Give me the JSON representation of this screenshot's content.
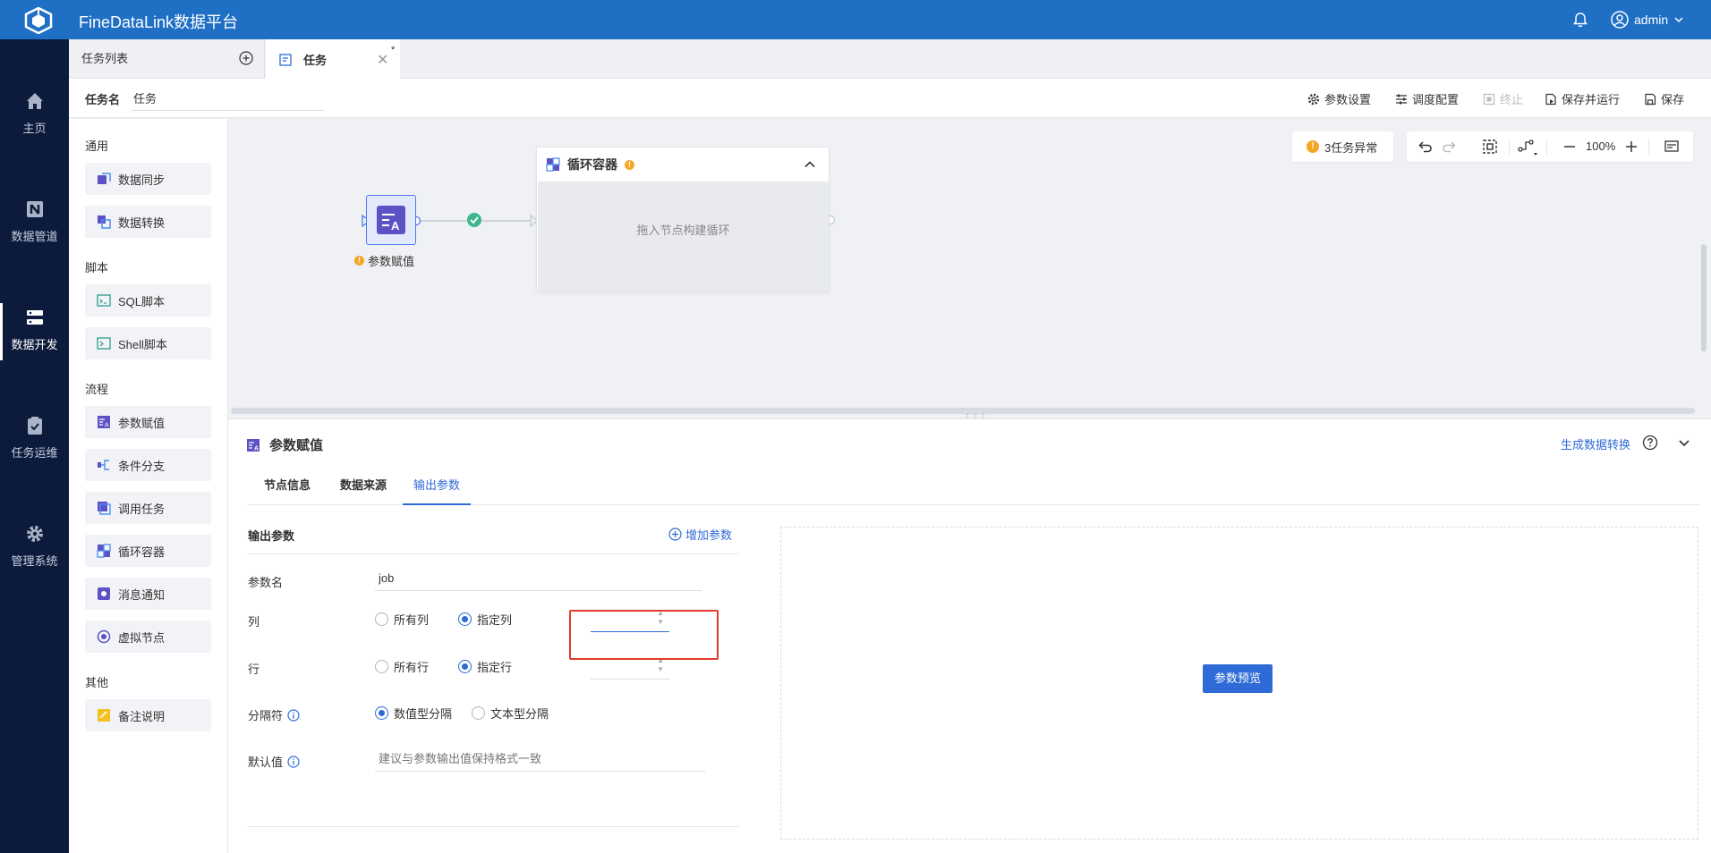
{
  "app": {
    "title": "FineDataLink数据平台",
    "user": "admin"
  },
  "leftnav": {
    "items": [
      {
        "label": "主页",
        "icon": "home-icon"
      },
      {
        "label": "数据管道",
        "icon": "pipeline-icon"
      },
      {
        "label": "数据开发",
        "icon": "data-dev-icon",
        "active": true
      },
      {
        "label": "任务运维",
        "icon": "task-ops-icon"
      },
      {
        "label": "管理系统",
        "icon": "gear-icon"
      }
    ]
  },
  "tabs": {
    "task_list": "任务列表",
    "current_tab": "任务",
    "modified_marker": "*"
  },
  "toolbar": {
    "task_name_label": "任务名",
    "task_name_value": "任务",
    "param_settings": "参数设置",
    "schedule_config": "调度配置",
    "stop": "终止",
    "save_run": "保存并运行",
    "save": "保存"
  },
  "node_panel": {
    "groups": [
      {
        "title": "通用",
        "items": [
          "数据同步",
          "数据转换"
        ]
      },
      {
        "title": "脚本",
        "items": [
          "SQL脚本",
          "Shell脚本"
        ]
      },
      {
        "title": "流程",
        "items": [
          "参数赋值",
          "条件分支",
          "调用任务",
          "循环容器",
          "消息通知",
          "虚拟节点"
        ]
      },
      {
        "title": "其他",
        "items": [
          "备注说明"
        ]
      }
    ]
  },
  "canvas": {
    "param_node_label": "参数赋值",
    "loop_title": "循环容器",
    "loop_placeholder": "拖入节点构建循环",
    "exception_badge": "3任务异常",
    "zoom": "100%"
  },
  "bottom_panel": {
    "title": "参数赋值",
    "generate_link": "生成数据转换",
    "tabs": [
      "节点信息",
      "数据来源",
      "输出参数"
    ],
    "active_tab": "输出参数",
    "section_title": "输出参数",
    "add_param": "增加参数",
    "param_name_label": "参数名",
    "param_name_value": "job",
    "column_label": "列",
    "column_all": "所有列",
    "column_specified": "指定列",
    "row_label": "行",
    "row_all": "所有行",
    "row_specified": "指定行",
    "separator_label": "分隔符",
    "separator_numeric": "数值型分隔",
    "separator_text": "文本型分隔",
    "default_label": "默认值",
    "default_placeholder": "建议与参数输出值保持格式一致",
    "preview_button": "参数预览"
  },
  "colors": {
    "brand": "#1f6fc5",
    "nav_bg": "#0c1b3b",
    "accent": "#2e6bd6",
    "warning": "#f5a623",
    "highlight": "#e23b2e"
  }
}
